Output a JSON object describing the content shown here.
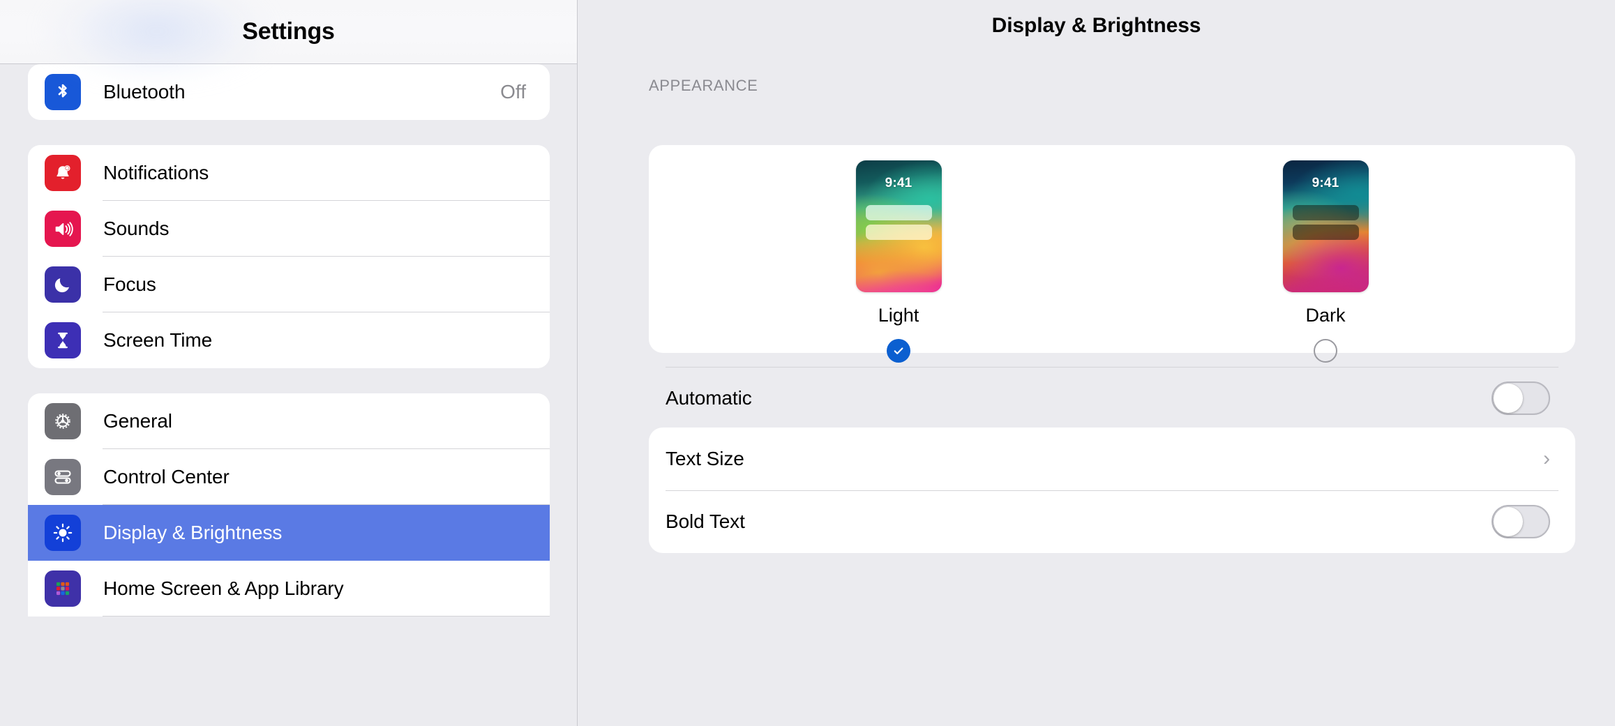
{
  "sidebar": {
    "title": "Settings",
    "groups": [
      {
        "id": "connectivity",
        "items": [
          {
            "label": "Bluetooth",
            "value": "Off",
            "icon": "bluetooth-icon",
            "icon_color": "#1858d8",
            "selected": false
          }
        ]
      },
      {
        "id": "alerts",
        "items": [
          {
            "label": "Notifications",
            "value": "",
            "icon": "bell-icon",
            "icon_color": "#e3202c",
            "selected": false
          },
          {
            "label": "Sounds",
            "value": "",
            "icon": "speaker-icon",
            "icon_color": "#e5164f",
            "selected": false
          },
          {
            "label": "Focus",
            "value": "",
            "icon": "moon-icon",
            "icon_color": "#3b31a8",
            "selected": false
          },
          {
            "label": "Screen Time",
            "value": "",
            "icon": "hourglass-icon",
            "icon_color": "#3d2fb5",
            "selected": false
          }
        ]
      },
      {
        "id": "system",
        "items": [
          {
            "label": "General",
            "value": "",
            "icon": "gear-icon",
            "icon_color": "#6e6e73",
            "selected": false
          },
          {
            "label": "Control Center",
            "value": "",
            "icon": "sliders-icon",
            "icon_color": "#787880",
            "selected": false
          },
          {
            "label": "Display & Brightness",
            "value": "",
            "icon": "brightness-icon",
            "icon_color": "#1340d8",
            "selected": true
          },
          {
            "label": "Home Screen & App Library",
            "value": "",
            "icon": "app-grid-icon",
            "icon_color": "#3f31a8",
            "selected": false
          }
        ]
      }
    ]
  },
  "detail": {
    "title": "Display & Brightness",
    "appearance": {
      "section_label": "APPEARANCE",
      "options": [
        {
          "id": "light",
          "label": "Light",
          "preview_time": "9:41",
          "selected": true
        },
        {
          "id": "dark",
          "label": "Dark",
          "preview_time": "9:41",
          "selected": false
        }
      ],
      "automatic": {
        "label": "Automatic",
        "enabled": false
      }
    },
    "display": {
      "rows": [
        {
          "id": "text-size",
          "label": "Text Size",
          "type": "disclosure",
          "chevron": "›"
        },
        {
          "id": "bold-text",
          "label": "Bold Text",
          "type": "toggle",
          "enabled": false
        }
      ]
    }
  },
  "colors": {
    "selection_blue": "#5a7ae4",
    "accent_blue": "#0b5fd0",
    "page_background": "#ebebef",
    "card_background": "#ffffff"
  }
}
